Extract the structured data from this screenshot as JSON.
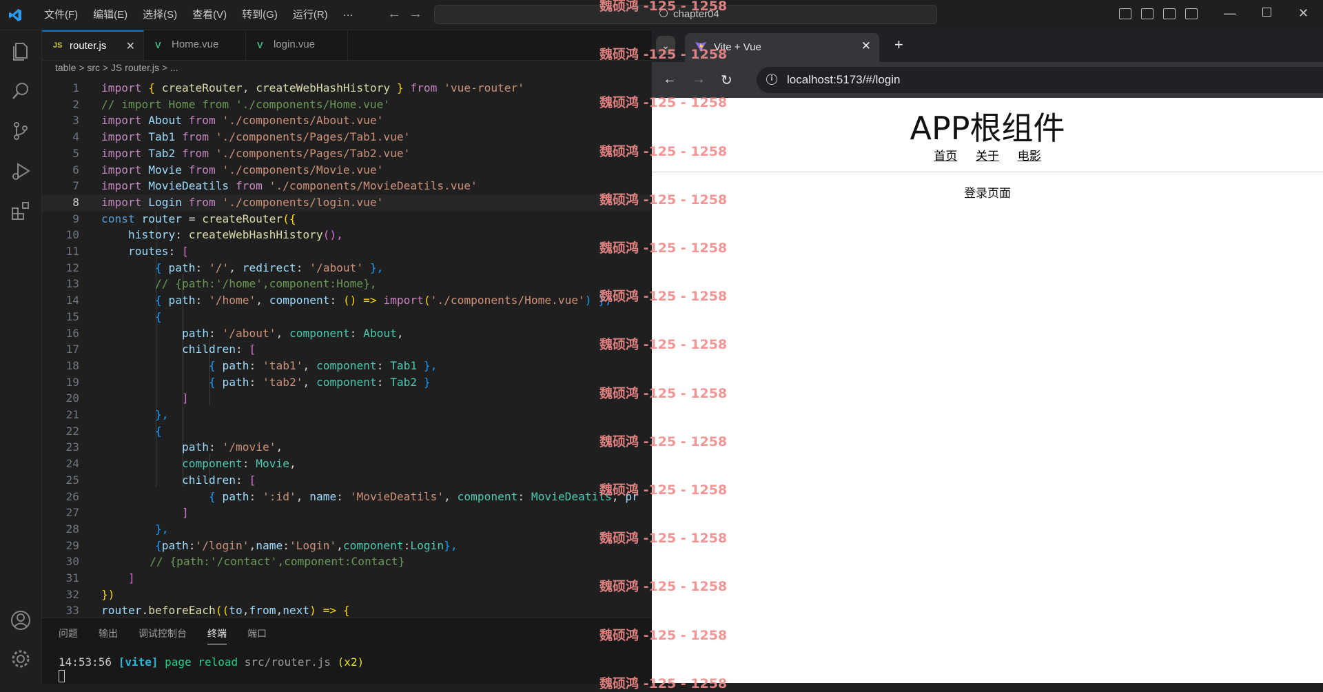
{
  "titlebar": {
    "menu": [
      "文件(F)",
      "编辑(E)",
      "选择(S)",
      "查看(V)",
      "转到(G)",
      "运行(R)",
      "···"
    ],
    "search_text": "chapter04"
  },
  "editor_tabs": [
    {
      "icon": "JS",
      "label": "router.js",
      "active": true
    },
    {
      "icon": "V",
      "label": "Home.vue",
      "active": false
    },
    {
      "icon": "V",
      "label": "login.vue",
      "active": false
    }
  ],
  "breadcrumb": "table > src > JS router.js > ...",
  "code_lines": [
    "1",
    "2",
    "3",
    "4",
    "5",
    "6",
    "7",
    "8",
    "9",
    "10",
    "11",
    "12",
    "13",
    "14",
    "15",
    "16",
    "17",
    "18",
    "19",
    "20",
    "21",
    "22",
    "23",
    "24",
    "25",
    "26",
    "27",
    "28",
    "29",
    "30",
    "31",
    "32",
    "33"
  ],
  "code_text": {
    "l1": [
      "import",
      " { ",
      "createRouter",
      ", ",
      "createWebHashHistory",
      " } ",
      "from",
      " ",
      "'vue-router'"
    ],
    "l2": "// import Home from './components/Home.vue'",
    "l3": [
      "import",
      " About ",
      "from",
      " ",
      "'./components/About.vue'"
    ],
    "l4": [
      "import",
      " Tab1 ",
      "from",
      " ",
      "'./components/Pages/Tab1.vue'"
    ],
    "l5": [
      "import",
      " Tab2 ",
      "from",
      " ",
      "'./components/Pages/Tab2.vue'"
    ],
    "l6": [
      "import",
      " Movie ",
      "from",
      " ",
      "'./components/Movie.vue'"
    ],
    "l7": [
      "import",
      " MovieDeatils ",
      "from",
      " ",
      "'./components/MovieDeatils.vue'"
    ],
    "l8": [
      "import",
      " Login ",
      "from",
      " ",
      "'./components/login.vue'"
    ],
    "l9": [
      "const",
      " ",
      "router",
      " = ",
      "createRouter",
      "({"
    ],
    "l10": [
      "history",
      ": ",
      "createWebHashHistory",
      "(),"
    ],
    "l11": [
      "routes",
      ": ",
      "["
    ],
    "l12": [
      "{ ",
      "path",
      ": ",
      "'/'",
      ", ",
      "redirect",
      ": ",
      "'/about'",
      " },"
    ],
    "l13": "// {path:'/home',component:Home},",
    "l14": [
      "{ ",
      "path",
      ": ",
      "'/home'",
      ", ",
      "component",
      ": ",
      "() => ",
      "import",
      "(",
      "'./components/Home.vue'",
      ") },"
    ],
    "l15": "{",
    "l16": [
      "path",
      ": ",
      "'/about'",
      ", ",
      "component",
      ": ",
      "About",
      ","
    ],
    "l17": [
      "children",
      ": ",
      "["
    ],
    "l18": [
      "{ ",
      "path",
      ": ",
      "'tab1'",
      ", ",
      "component",
      ": ",
      "Tab1",
      " },"
    ],
    "l19": [
      "{ ",
      "path",
      ": ",
      "'tab2'",
      ", ",
      "component",
      ": ",
      "Tab2",
      " }"
    ],
    "l20": "]",
    "l21": "},",
    "l22": "{",
    "l23": [
      "path",
      ": ",
      "'/movie'",
      ","
    ],
    "l24": [
      "component",
      ": ",
      "Movie",
      ","
    ],
    "l25": [
      "children",
      ": ",
      "["
    ],
    "l26": [
      "{ ",
      "path",
      ": ",
      "':id'",
      ", ",
      "name",
      ": ",
      "'MovieDeatils'",
      ", ",
      "component",
      ": ",
      "MovieDeatils",
      ", ",
      "pr"
    ],
    "l27": "]",
    "l28": "},",
    "l29": [
      "{",
      "path",
      ":",
      "'/login'",
      ",",
      "name",
      ":",
      "'Login'",
      ",",
      "component",
      ":",
      "Login",
      "},"
    ],
    "l30": "// {path:'/contact',component:Contact}",
    "l31": "]",
    "l32": "})",
    "l33": [
      "router",
      ".",
      "beforeEach",
      "((",
      "to",
      ",",
      "from",
      ",",
      "next",
      ") => {"
    ]
  },
  "panel": {
    "tabs": [
      "问题",
      "输出",
      "调试控制台",
      "终端",
      "端口"
    ],
    "active_tab": "终端",
    "terminal": {
      "time": "14:53:56",
      "tag": "[vite]",
      "msg": "page reload",
      "file": "src/router.js",
      "count": "(x2)"
    }
  },
  "browser": {
    "tab_title": "Vite + Vue",
    "url": "localhost:5173/#/login",
    "page": {
      "title": "APP根组件",
      "nav": [
        "首页",
        "关于",
        "电影"
      ],
      "view_text": "登录页面"
    }
  },
  "watermark": "魏硕鸿 -125 - 1258",
  "colors": {
    "accent": "#0078d4",
    "keyword": "#c586c0",
    "string": "#ce9178",
    "comment": "#6a9955",
    "function": "#dcdcaa",
    "variable": "#9cdcfe",
    "watermark": "#f08a8a"
  }
}
